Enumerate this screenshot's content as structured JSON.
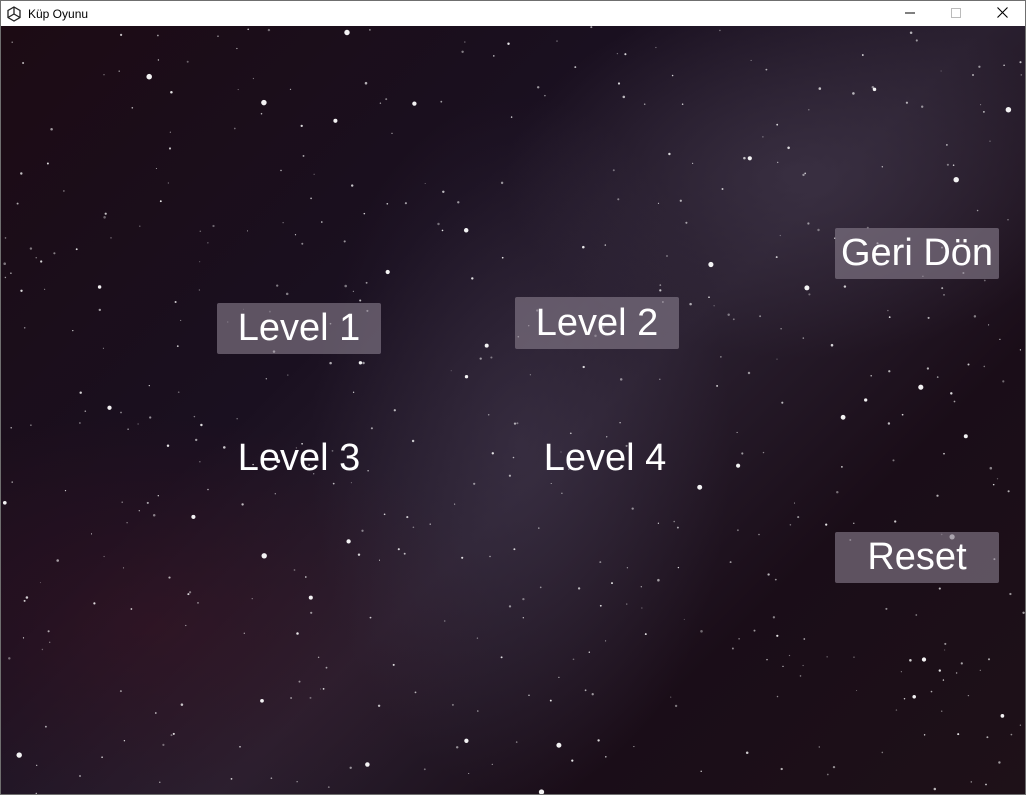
{
  "window": {
    "title": "Küp Oyunu",
    "app_icon": "unity-icon",
    "controls": [
      "minimize-icon",
      "maximize-icon",
      "close-icon"
    ]
  },
  "menu": {
    "level1": "Level 1",
    "level2": "Level 2",
    "level3": "Level 3",
    "level4": "Level 4",
    "back": "Geri Dön",
    "reset": "Reset"
  },
  "colors": {
    "button_bg": "#827887",
    "button_text": "#ffffff",
    "background": "#1c0b14"
  }
}
